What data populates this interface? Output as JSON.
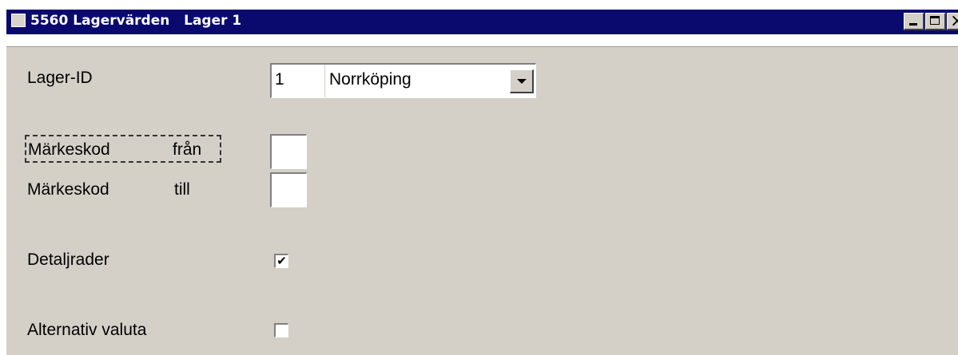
{
  "window": {
    "title": "5560 Lagervärden   Lager 1",
    "title_icon": "app-window-icon",
    "colors": {
      "titlebar": "#0a0a6e",
      "panel": "#d4d0c8"
    }
  },
  "form": {
    "lager_id": {
      "label": "Lager-ID",
      "id_value": "1",
      "name_value": "Norrköping"
    },
    "markeskod_fran": {
      "label": "Märkeskod",
      "suffix": "från",
      "value": ""
    },
    "markeskod_till": {
      "label": "Märkeskod",
      "suffix": "till",
      "value": ""
    },
    "detaljrader": {
      "label": "Detaljrader",
      "checked": true,
      "mark": "✔"
    },
    "alternativ_valuta": {
      "label": "Alternativ valuta",
      "checked": false,
      "mark": ""
    }
  }
}
